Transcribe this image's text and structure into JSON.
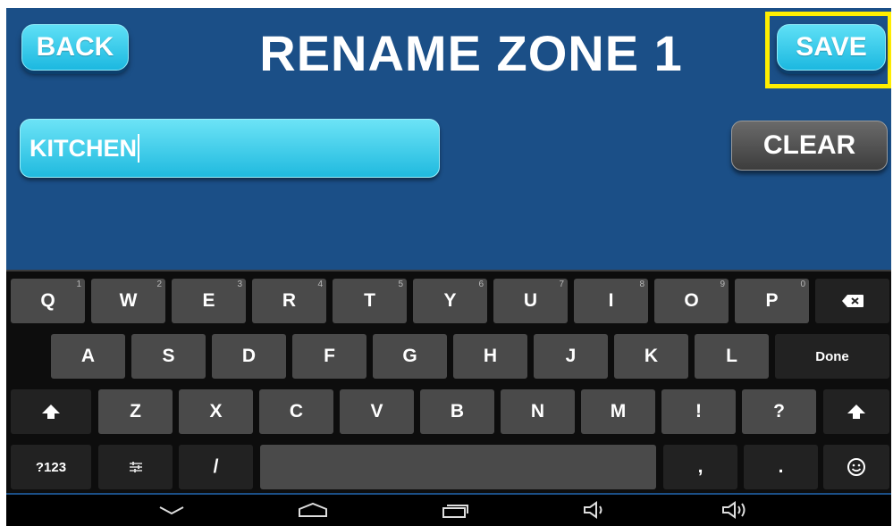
{
  "header": {
    "back_label": "BACK",
    "title": "RENAME ZONE 1",
    "save_label": "SAVE"
  },
  "name_field": {
    "value": "KITCHEN"
  },
  "clear_label": "CLEAR",
  "keyboard": {
    "row1": [
      {
        "label": "Q",
        "hint": "1"
      },
      {
        "label": "W",
        "hint": "2"
      },
      {
        "label": "E",
        "hint": "3"
      },
      {
        "label": "R",
        "hint": "4"
      },
      {
        "label": "T",
        "hint": "5"
      },
      {
        "label": "Y",
        "hint": "6"
      },
      {
        "label": "U",
        "hint": "7"
      },
      {
        "label": "I",
        "hint": "8"
      },
      {
        "label": "O",
        "hint": "9"
      },
      {
        "label": "P",
        "hint": "0"
      }
    ],
    "row2": [
      "A",
      "S",
      "D",
      "F",
      "G",
      "H",
      "J",
      "K",
      "L"
    ],
    "done_label": "Done",
    "row3": [
      "Z",
      "X",
      "C",
      "V",
      "B",
      "N",
      "M",
      "!",
      "?"
    ],
    "symbols_label": "?123",
    "slash_label": "/",
    "comma_label": ",",
    "period_label": "."
  },
  "icons": {
    "backspace": "backspace-icon",
    "shift": "shift-icon",
    "settings": "keyboard-settings-icon",
    "emoji": "emoji-icon",
    "nav_back": "nav-back-icon",
    "nav_home": "nav-home-icon",
    "nav_recents": "nav-recents-icon",
    "volume_down": "volume-down-icon",
    "volume_up": "volume-up-icon"
  },
  "colors": {
    "background": "#1b4f87",
    "button_accent": "#1cb8e0",
    "highlight": "#ffee00",
    "keyboard_bg": "#0d0d0d",
    "key_bg": "#4a4a4a"
  }
}
